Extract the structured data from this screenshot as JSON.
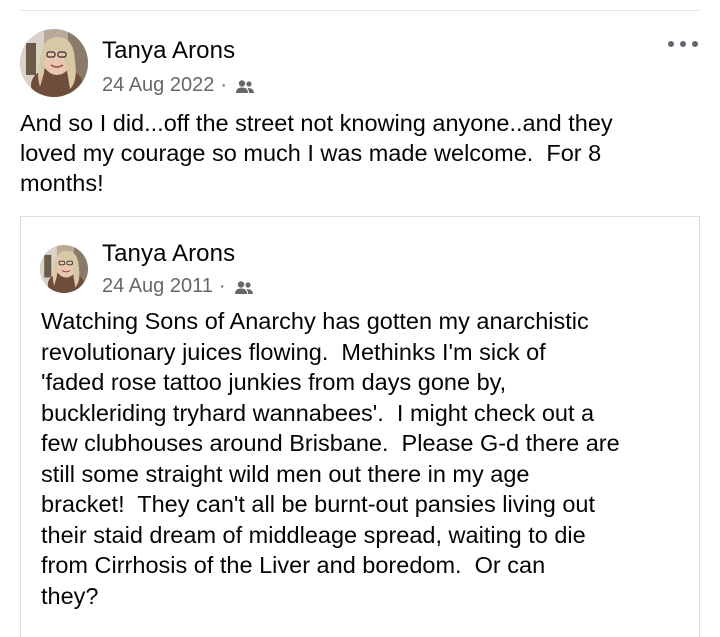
{
  "post": {
    "author": "Tanya Arons",
    "date": "24 Aug 2022",
    "separator": "·",
    "audience_icon": "friends-icon",
    "more_icon": "more-options-icon",
    "text": "And so I did...off the street not knowing anyone..and they\nloved my courage so much I was made welcome.  For 8\nmonths!"
  },
  "shared_post": {
    "author": "Tanya Arons",
    "date": "24 Aug 2011",
    "separator": "·",
    "audience_icon": "friends-icon",
    "text": "Watching Sons of Anarchy has gotten my anarchistic\nrevolutionary juices flowing.  Methinks I'm sick of\n'faded rose tattoo junkies from days gone by,\nbuckleriding tryhard wannabees'.  I might check out a\nfew clubhouses around Brisbane.  Please G-d there are\nstill some straight wild men out there in my age\nbracket!  They can't all be burnt-out pansies living out\ntheir staid dream of middleage spread, waiting to die\nfrom Cirrhosis of the Liver and boredom.  Or can\nthey?"
  },
  "colors": {
    "text": "#050505",
    "secondary_text": "#65676b",
    "divider": "#e4e6eb",
    "card_border": "#dadde1"
  }
}
